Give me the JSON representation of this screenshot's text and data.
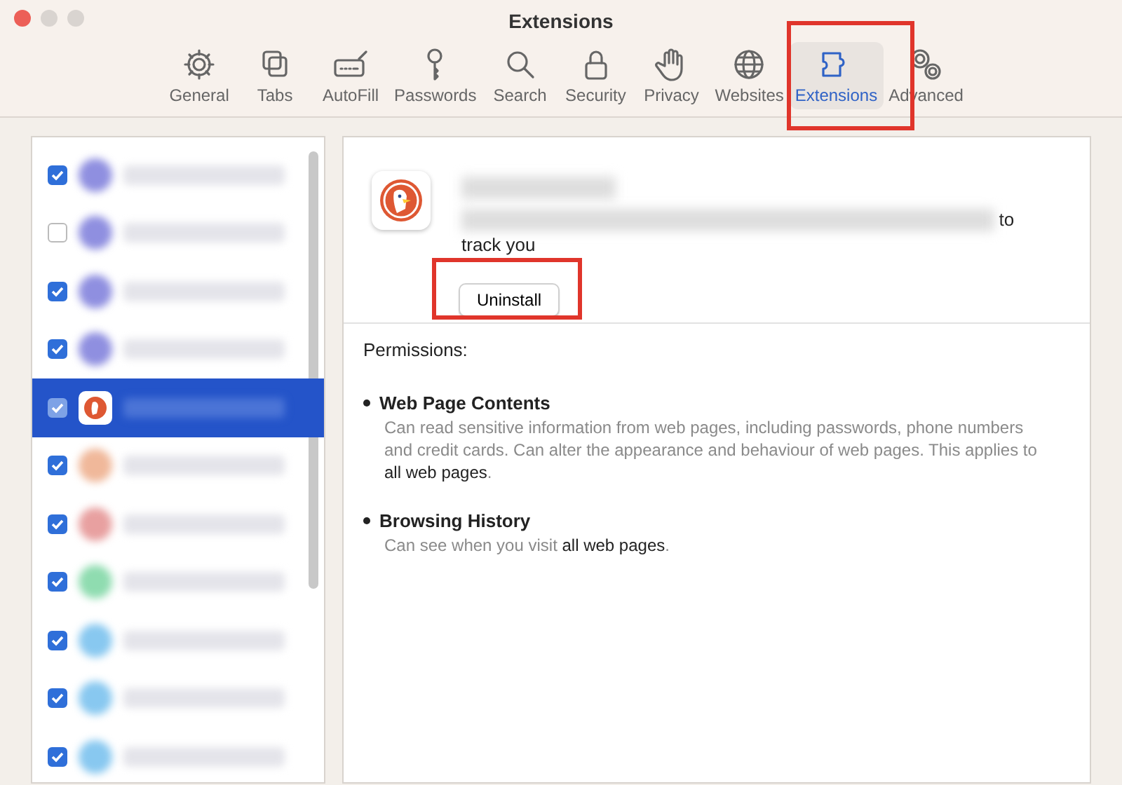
{
  "window": {
    "title": "Extensions"
  },
  "toolbar": [
    {
      "label": "General",
      "kind": "gear",
      "selected": false
    },
    {
      "label": "Tabs",
      "kind": "tabs",
      "selected": false
    },
    {
      "label": "AutoFill",
      "kind": "autofill",
      "selected": false
    },
    {
      "label": "Passwords",
      "kind": "key",
      "selected": false
    },
    {
      "label": "Search",
      "kind": "search",
      "selected": false
    },
    {
      "label": "Security",
      "kind": "lock",
      "selected": false
    },
    {
      "label": "Privacy",
      "kind": "hand",
      "selected": false
    },
    {
      "label": "Websites",
      "kind": "globe",
      "selected": false
    },
    {
      "label": "Extensions",
      "kind": "puzzle",
      "selected": true
    },
    {
      "label": "Advanced",
      "kind": "gears",
      "selected": false
    }
  ],
  "extensions": [
    {
      "checked": true,
      "selected": false,
      "color": "#8f8fe0"
    },
    {
      "checked": false,
      "selected": false,
      "color": "#8f8fe0"
    },
    {
      "checked": true,
      "selected": false,
      "color": "#8f8fe0"
    },
    {
      "checked": true,
      "selected": false,
      "color": "#8f8fe0"
    },
    {
      "checked": true,
      "selected": true,
      "color": "#de5833"
    },
    {
      "checked": true,
      "selected": false,
      "color": "#f0b89a"
    },
    {
      "checked": true,
      "selected": false,
      "color": "#e8a0a0"
    },
    {
      "checked": true,
      "selected": false,
      "color": "#8fdcb0"
    },
    {
      "checked": true,
      "selected": false,
      "color": "#88c8f0"
    },
    {
      "checked": true,
      "selected": false,
      "color": "#88c8f0"
    },
    {
      "checked": true,
      "selected": false,
      "color": "#88c8f0"
    }
  ],
  "detail": {
    "description_end": "to",
    "description_next": "track you",
    "uninstall_button": "Uninstall",
    "permissions_label": "Permissions:",
    "permissions": [
      {
        "title": "Web Page Contents",
        "text": "Can read sensitive information from web pages, including passwords, phone numbers and credit cards. Can alter the appearance and behaviour of web pages. This applies to **all web pages**."
      },
      {
        "title": "Browsing History",
        "text": "Can see when you visit **all web pages**."
      }
    ]
  }
}
